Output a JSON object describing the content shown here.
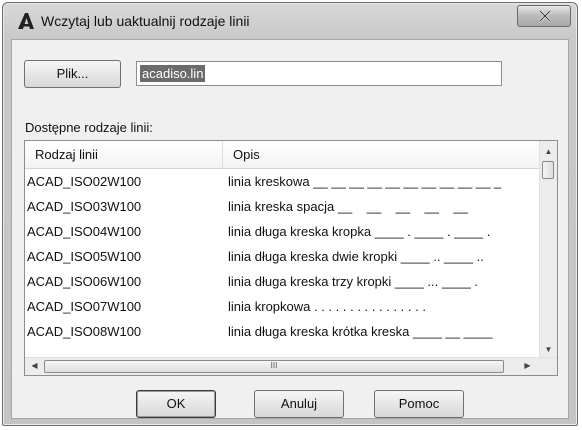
{
  "window": {
    "title": "Wczytaj lub uaktualnij rodzaje linii"
  },
  "file": {
    "button_label": "Plik...",
    "value": "acadiso.lin"
  },
  "list": {
    "label": "Dostępne rodzaje linii:",
    "columns": [
      "Rodzaj linii",
      "Opis"
    ],
    "rows": [
      {
        "name": "ACAD_ISO02W100",
        "desc": "linia kreskowa __ __ __ __ __ __ __ __ __ __ _"
      },
      {
        "name": "ACAD_ISO03W100",
        "desc": "linia kreska spacja __    __    __    __    __"
      },
      {
        "name": "ACAD_ISO04W100",
        "desc": "linia długa kreska kropka ____ . ____ . ____ ."
      },
      {
        "name": "ACAD_ISO05W100",
        "desc": "linia długa kreska dwie kropki ____ .. ____ .."
      },
      {
        "name": "ACAD_ISO06W100",
        "desc": "linia długa kreska trzy kropki ____ ... ____ ."
      },
      {
        "name": "ACAD_ISO07W100",
        "desc": "linia kropkowa . . . . . . . . . . . . . . . ."
      },
      {
        "name": "ACAD_ISO08W100",
        "desc": "linia długa kreska krótka kreska ____ __ ____"
      }
    ]
  },
  "buttons": {
    "ok": "OK",
    "cancel": "Anuluj",
    "help": "Pomoc"
  },
  "scroll": {
    "h_grip": "III"
  },
  "colors": {
    "selection": "#6b6b6b",
    "titlebar": "#d0d0d0"
  }
}
